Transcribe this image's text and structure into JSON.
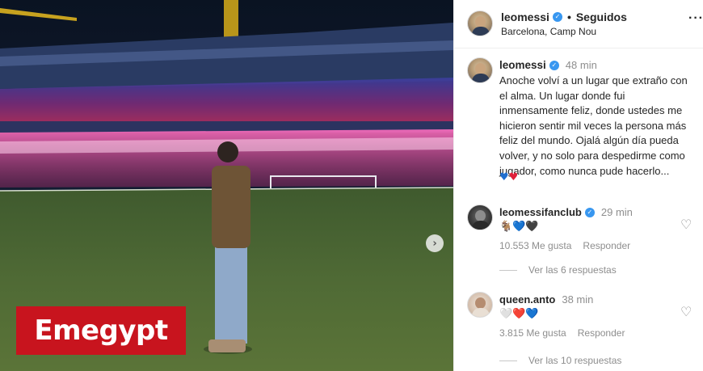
{
  "post": {
    "username": "leomessi",
    "follow_state": "Seguidos",
    "location": "Barcelona, Camp Nou",
    "more_icon": "more-options-icon"
  },
  "caption": {
    "username": "leomessi",
    "time": "48 min",
    "text": "Anoche volví a un lugar que extraño con el alma. Un lugar donde fui inmensamente feliz, donde ustedes me hicieron sentir mil veces la persona más feliz del mundo. Ojalá algún día pueda volver, y no solo para despedirme como jugador, como nunca pude hacerlo...",
    "emoji": "💙❤"
  },
  "comments": [
    {
      "username": "leomessifanclub",
      "verified": true,
      "time": "29 min",
      "text": "🐐💙🖤",
      "likes": "10.553 Me gusta",
      "reply_label": "Responder",
      "replies": "Ver las 6 respuestas"
    },
    {
      "username": "queen.anto",
      "verified": false,
      "time": "38 min",
      "text": "🤍❤️💙",
      "likes": "3.815 Me gusta",
      "reply_label": "Responder",
      "replies": "Ver las 10 respuestas"
    }
  ],
  "watermark": {
    "text": "Emegypt",
    "color": "#c8141e"
  },
  "colors": {
    "verified": "#3897f0",
    "muted_text": "#8e8e8e",
    "primary_text": "#262626"
  }
}
